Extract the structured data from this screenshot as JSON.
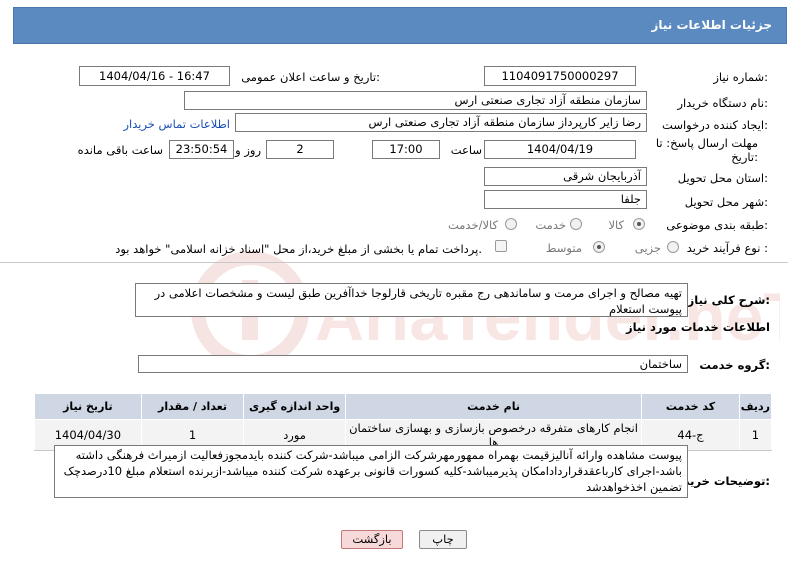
{
  "header": {
    "title": "جزئیات اطلاعات نیاز"
  },
  "fields": {
    "need_number_label": "شماره نیاز:",
    "need_number": "1104091750000297",
    "announce_label": "تاریخ و ساعت اعلان عمومی:",
    "announce_value": "1404/04/16 - 16:47",
    "buyer_org_label": "نام دستگاه خریدار:",
    "buyer_org": "سازمان منطقه آزاد تجاری صنعتی ارس",
    "requester_label": "ایجاد کننده درخواست:",
    "requester": "رضا زایر کارپرداز سازمان منطقه آزاد تجاری صنعتی ارس",
    "contact_link": "اطلاعات تماس خریدار",
    "deadline_label_1": "مهلت ارسال پاسخ: تا",
    "deadline_label_2": "تاریخ:",
    "deadline_date": "1404/04/19",
    "hour_label": "ساعت",
    "deadline_hour": "17:00",
    "days_value": "2",
    "days_label": "روز و",
    "remaining_time": "23:50:54",
    "remaining_label": "ساعت باقی مانده",
    "province_label": "استان محل تحویل:",
    "province": "آذربایجان شرقی",
    "city_label": "شهر محل تحویل:",
    "city": "جلفا",
    "category_label": "طبقه بندی موضوعی:",
    "category_options": [
      "کالا",
      "خدمت",
      "کالا/خدمت"
    ],
    "process_label": "نوع فرآیند خرید :",
    "process_options": [
      "جزیی",
      "متوسط"
    ],
    "payment_note": "پرداخت تمام یا بخشی از مبلغ خرید،از محل \"اسناد خزانه اسلامی\" خواهد بود."
  },
  "summary": {
    "label": "شرح کلی نیاز:",
    "text": "تهیه مصالح و اجرای مرمت و ساماندهی رج مقبره تاریخی قارلوجا خداآفرین طبق لیست و مشخصات اعلامی در پیوست استعلام"
  },
  "services": {
    "section_title": "اطلاعات خدمات مورد نیاز",
    "group_label": "گروه خدمت:",
    "group_value": "ساختمان",
    "columns": [
      "ردیف",
      "کد خدمت",
      "نام خدمت",
      "واحد اندازه گیری",
      "تعداد / مقدار",
      "تاریخ نیاز"
    ],
    "rows": [
      [
        "1",
        "ج-44",
        "انجام کارهای متفرقه درخصوص بازسازی و بهسازی ساختمان ها",
        "مورد",
        "1",
        "1404/04/30"
      ]
    ]
  },
  "buyer_notes": {
    "label": "توضیحات خریدار:",
    "text": "پیوست مشاهده وارائه آنالیزقیمت بهمراه ممهورمهرشرکت الزامی میباشد-شرکت کننده بایدمجوزفعالیت ازمیراث فرهنگی داشته باشد-اجرای کاربا‌عقدقرارداد‌امکان پذیرمیباشد-کلیه کسورات قانونی برعهده شرکت کننده میباشد-ازبرنده استعلام مبلغ 10درصدچک تضمین اخذخواهدشد"
  },
  "buttons": {
    "print": "چاپ",
    "back": "بازگشت"
  },
  "watermark": {
    "text": "AriaTender.neT"
  },
  "colors": {
    "header_bg": "#5a8ac0",
    "table_header_bg": "#cfd7e4",
    "link": "#1a4fb5"
  }
}
